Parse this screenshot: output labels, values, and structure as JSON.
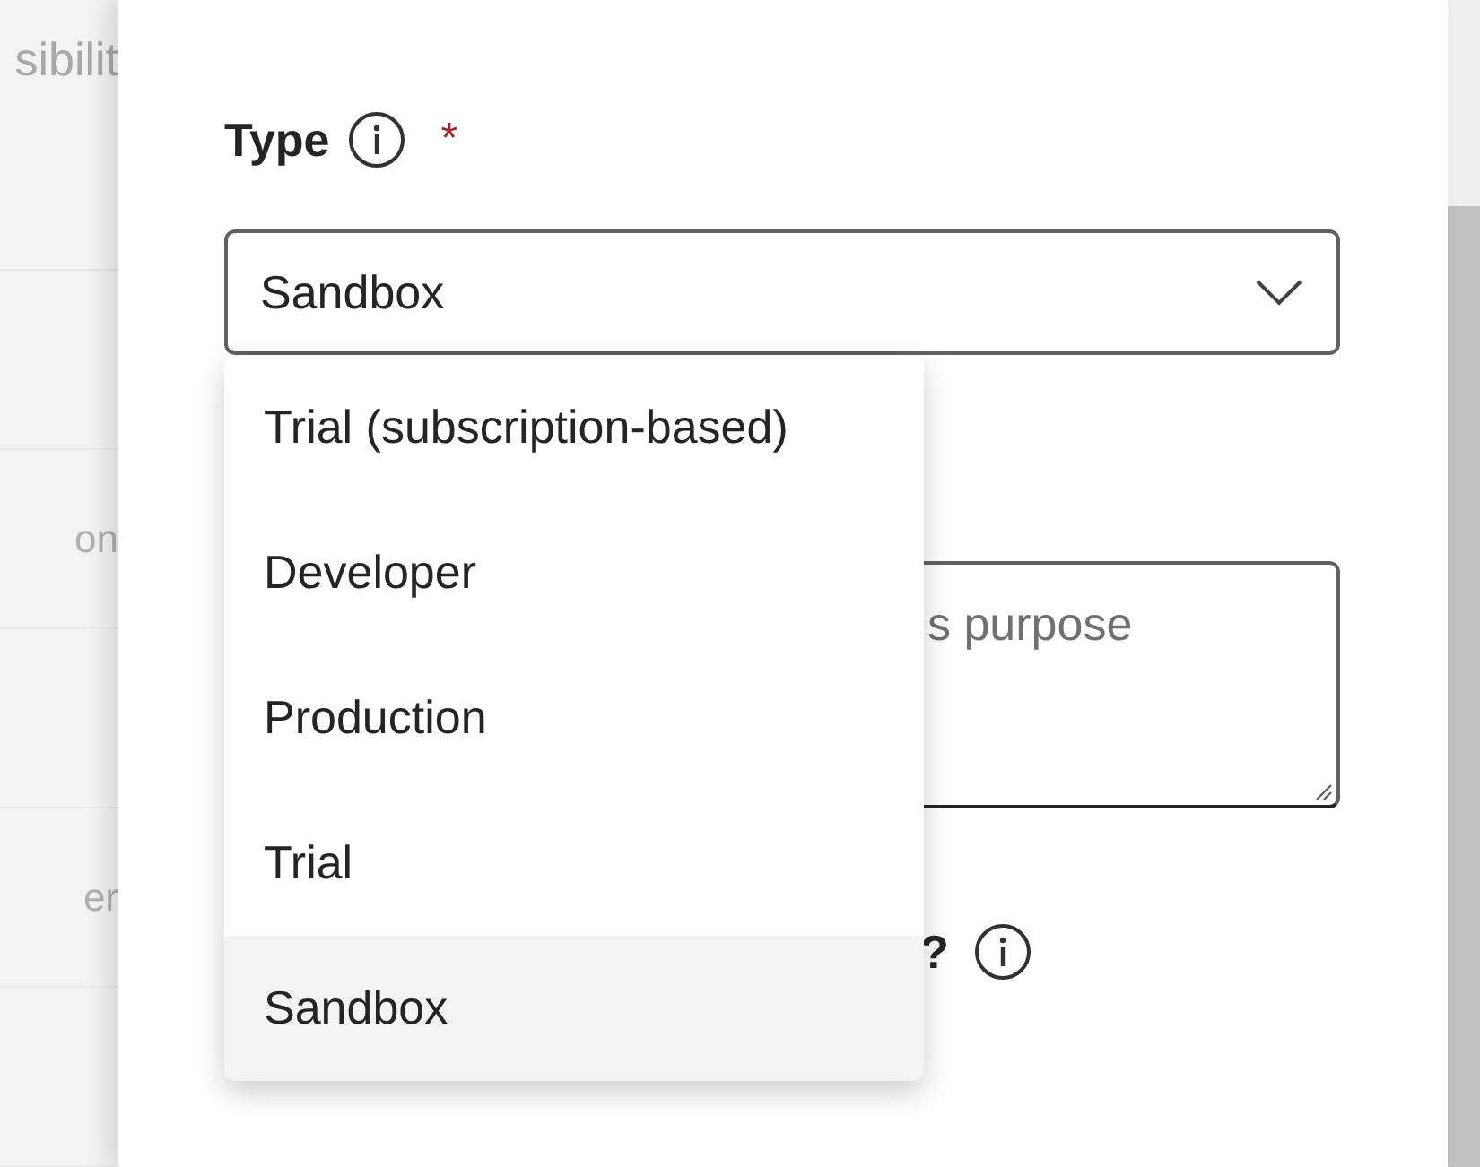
{
  "background": {
    "heading": "sibilit",
    "rows": [
      {
        "text": ""
      },
      {
        "text": "on"
      },
      {
        "text": ""
      },
      {
        "text": "er"
      },
      {
        "text": ""
      }
    ]
  },
  "form": {
    "type_label": "Type",
    "required_mark": "*",
    "select_value": "Sandbox",
    "options": [
      {
        "label": "Trial (subscription-based)",
        "selected": false
      },
      {
        "label": "Developer",
        "selected": false
      },
      {
        "label": "Production",
        "selected": false
      },
      {
        "label": "Trial",
        "selected": false
      },
      {
        "label": "Sandbox",
        "selected": true
      }
    ],
    "description_placeholder": "s purpose",
    "question_label": "?"
  }
}
